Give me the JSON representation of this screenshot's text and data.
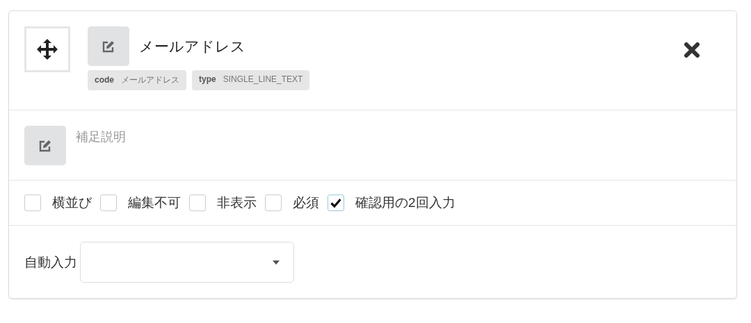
{
  "field": {
    "label": "メールアドレス",
    "tags": [
      {
        "key": "code",
        "value": "メールアドレス"
      },
      {
        "key": "type",
        "value": "SINGLE_LINE_TEXT"
      }
    ]
  },
  "description": {
    "placeholder": "補足説明"
  },
  "options": [
    {
      "label": "横並び",
      "checked": false
    },
    {
      "label": "編集不可",
      "checked": false
    },
    {
      "label": "非表示",
      "checked": false
    },
    {
      "label": "必須",
      "checked": false
    },
    {
      "label": "確認用の2回入力",
      "checked": true
    }
  ],
  "autofill": {
    "label": "自動入力"
  }
}
